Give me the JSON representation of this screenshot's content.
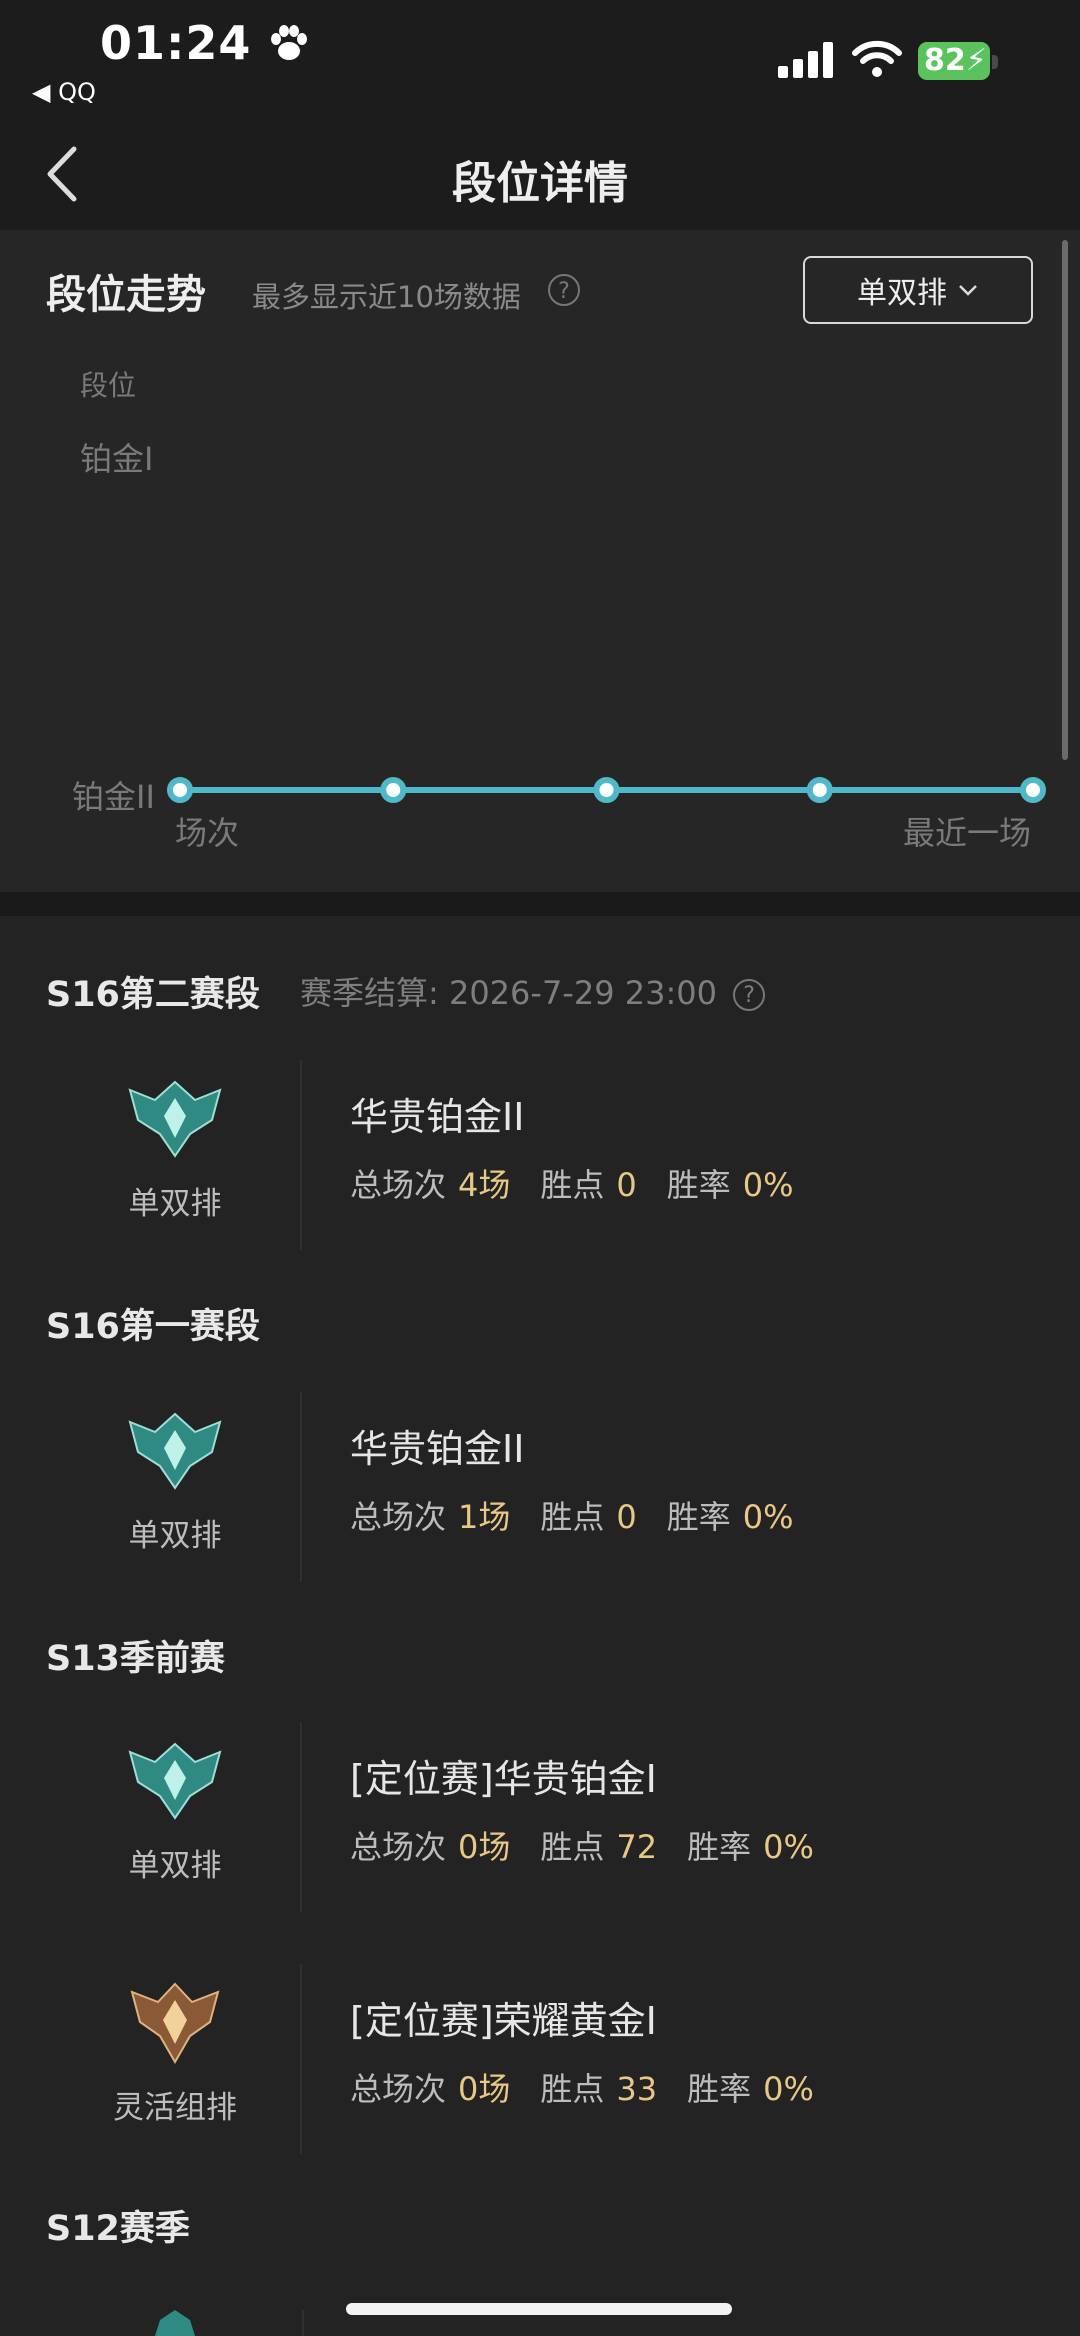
{
  "status_bar": {
    "time": "01:24",
    "back_app": "◀ QQ",
    "battery": "82"
  },
  "nav": {
    "title": "段位详情"
  },
  "trend": {
    "title": "段位走势",
    "note": "最多显示近10场数据",
    "help": "?",
    "queue_select": "单双排",
    "y_axis_title": "段位",
    "x_start": "场次",
    "x_end": "最近一场"
  },
  "chart_data": {
    "type": "line",
    "title": "段位走势",
    "ylabel": "段位",
    "xlabel": "场次",
    "y_categories": [
      "铂金II",
      "铂金I"
    ],
    "x": [
      1,
      2,
      3,
      4,
      5
    ],
    "series": [
      {
        "values": [
          "铂金II",
          "铂金II",
          "铂金II",
          "铂金II",
          "铂金II"
        ]
      }
    ],
    "x_end_label": "最近一场",
    "color": "#4fb8c9"
  },
  "seasons": [
    {
      "title": "S16第二赛段",
      "settle": "赛季结算: 2026-7-29 23:00",
      "ranks": [
        {
          "queue": "单双排",
          "name": "华贵铂金II",
          "games_label": "总场次",
          "games": "4场",
          "points_label": "胜点",
          "points": "0",
          "winrate_label": "胜率",
          "winrate": "0%",
          "emblem": "platinum"
        }
      ]
    },
    {
      "title": "S16第一赛段",
      "ranks": [
        {
          "queue": "单双排",
          "name": "华贵铂金II",
          "games_label": "总场次",
          "games": "1场",
          "points_label": "胜点",
          "points": "0",
          "winrate_label": "胜率",
          "winrate": "0%",
          "emblem": "platinum"
        }
      ]
    },
    {
      "title": "S13季前赛",
      "ranks": [
        {
          "queue": "单双排",
          "name": "[定位赛]华贵铂金I",
          "games_label": "总场次",
          "games": "0场",
          "points_label": "胜点",
          "points": "72",
          "winrate_label": "胜率",
          "winrate": "0%",
          "emblem": "platinum"
        },
        {
          "queue": "灵活组排",
          "name": "[定位赛]荣耀黄金I",
          "games_label": "总场次",
          "games": "0场",
          "points_label": "胜点",
          "points": "33",
          "winrate_label": "胜率",
          "winrate": "0%",
          "emblem": "gold"
        }
      ]
    },
    {
      "title": "S12赛季"
    }
  ],
  "colors": {
    "background": "#232323",
    "accent_line": "#4fb8c9",
    "stat_value": "#e9c887",
    "battery": "#5ac35e"
  }
}
